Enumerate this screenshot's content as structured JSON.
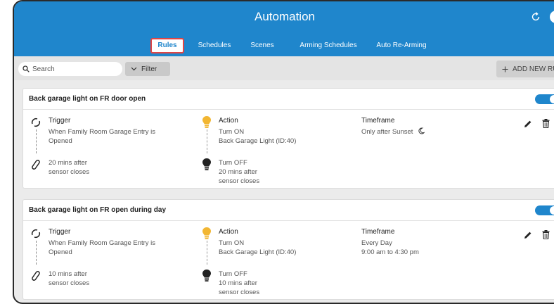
{
  "header": {
    "title": "Automation",
    "tabs": [
      {
        "label": "Rules",
        "active": true
      },
      {
        "label": "Schedules",
        "active": false
      },
      {
        "label": "Scenes",
        "active": false
      },
      {
        "label": "Arming Schedules",
        "active": false
      },
      {
        "label": "Auto Re-Arming",
        "active": false
      }
    ]
  },
  "toolbar": {
    "search_placeholder": "Search",
    "filter_label": "Filter",
    "add_label": "ADD NEW RULE"
  },
  "colors": {
    "accent": "#1f86cc",
    "bulb_on": "#f2b632",
    "bulb_off": "#222222",
    "active_tab_border": "#e04646"
  },
  "rules": [
    {
      "title": "Back garage light on FR door open",
      "enabled": true,
      "trigger_label": "Trigger",
      "trigger_text_1": "When Family Room Garage Entry is",
      "trigger_text_2": "Opened",
      "delay_text_1": "20 mins after",
      "delay_text_2": "sensor closes",
      "action_label": "Action",
      "action_on_1": "Turn ON",
      "action_on_2": "Back Garage Light (ID:40)",
      "action_off_1": "Turn OFF",
      "action_off_2": "20 mins after",
      "action_off_3": "sensor closes",
      "timeframe_label": "Timeframe",
      "timeframe_1": "Only after Sunset",
      "timeframe_2": "",
      "timeframe_icon": "moon-icon"
    },
    {
      "title": "Back garage light on FR open during day",
      "enabled": true,
      "trigger_label": "Trigger",
      "trigger_text_1": "When Family Room Garage Entry is",
      "trigger_text_2": "Opened",
      "delay_text_1": "10 mins after",
      "delay_text_2": "sensor closes",
      "action_label": "Action",
      "action_on_1": "Turn ON",
      "action_on_2": "Back Garage Light (ID:40)",
      "action_off_1": "Turn OFF",
      "action_off_2": "10 mins after",
      "action_off_3": "sensor closes",
      "timeframe_label": "Timeframe",
      "timeframe_1": "Every Day",
      "timeframe_2": "9:00 am to 4:30 pm"
    }
  ]
}
